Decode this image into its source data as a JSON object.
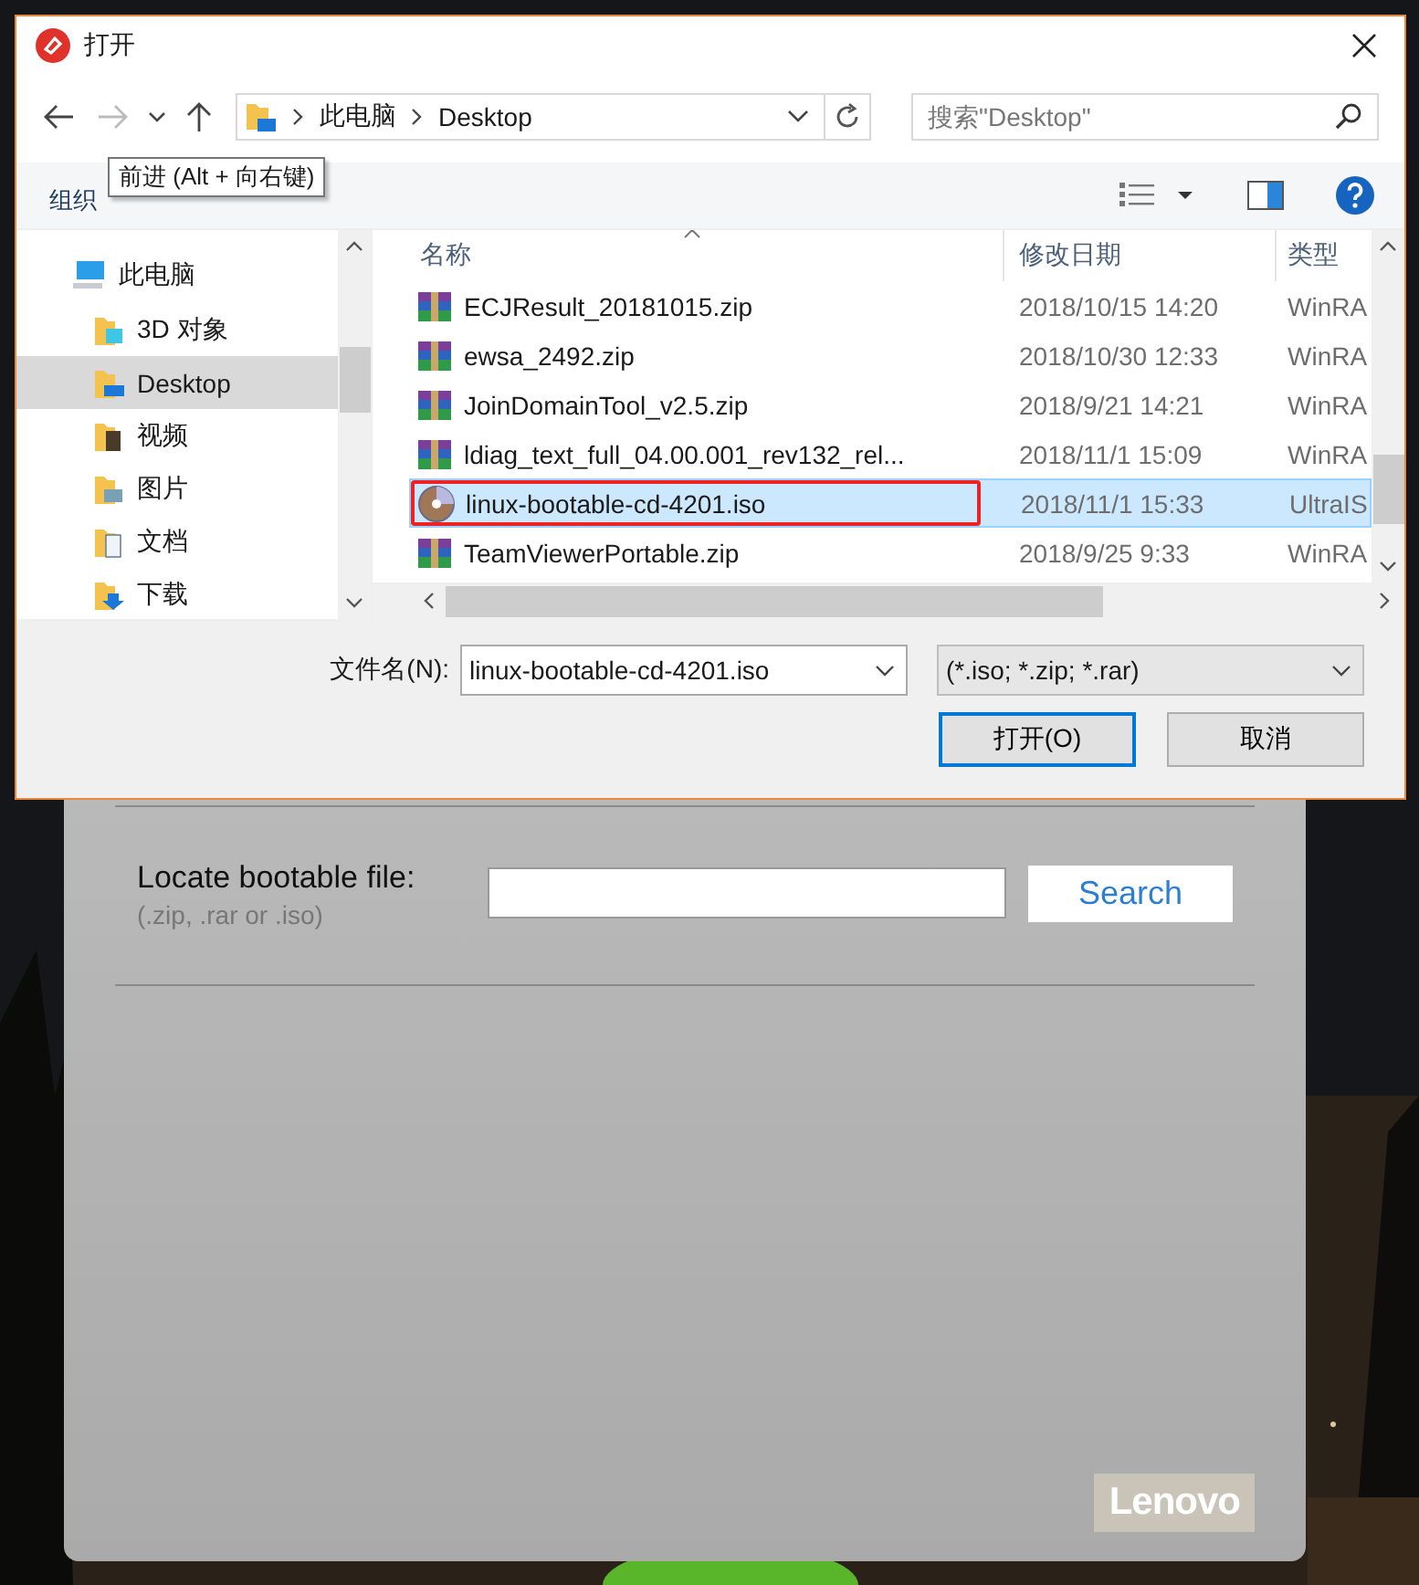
{
  "window": {
    "title": "打开"
  },
  "nav_buttons": [
    {
      "kind": "back",
      "disabled": false
    },
    {
      "kind": "forward",
      "disabled": true
    },
    {
      "kind": "recent",
      "disabled": false
    },
    {
      "kind": "up",
      "disabled": false
    }
  ],
  "address": {
    "crumbs": [
      "此电脑",
      "Desktop"
    ]
  },
  "search": {
    "placeholder": "搜索\"Desktop\""
  },
  "tooltip": "前进 (Alt + 向右键)",
  "toolbar": {
    "items": [
      "组织"
    ]
  },
  "sidebar": {
    "items": [
      {
        "label": "此电脑",
        "kind": "computer",
        "selected": false,
        "children": [
          {
            "label": "3D 对象",
            "kind": "objects",
            "selected": false
          },
          {
            "label": "Desktop",
            "kind": "desktop",
            "selected": true
          },
          {
            "label": "视频",
            "kind": "video",
            "selected": false
          },
          {
            "label": "图片",
            "kind": "pictures",
            "selected": false
          },
          {
            "label": "文档",
            "kind": "documents",
            "selected": false
          },
          {
            "label": "下载",
            "kind": "downloads",
            "selected": false
          }
        ]
      }
    ]
  },
  "table": {
    "columns": [
      "名称",
      "修改日期",
      "类型"
    ],
    "rows": [
      {
        "kind": "archive",
        "name": "ECJResult_20181015.zip",
        "date": "2018/10/15 14:20",
        "type": "WinRA",
        "selected": false,
        "annotated": false
      },
      {
        "kind": "archive",
        "name": "ewsa_2492.zip",
        "date": "2018/10/30 12:33",
        "type": "WinRA",
        "selected": false,
        "annotated": false
      },
      {
        "kind": "archive",
        "name": "JoinDomainTool_v2.5.zip",
        "date": "2018/9/21 14:21",
        "type": "WinRA",
        "selected": false,
        "annotated": false
      },
      {
        "kind": "archive",
        "name": "ldiag_text_full_04.00.001_rev132_rel...",
        "date": "2018/11/1 15:09",
        "type": "WinRA",
        "selected": false,
        "annotated": false
      },
      {
        "kind": "disc",
        "name": "linux-bootable-cd-4201.iso",
        "date": "2018/11/1 15:33",
        "type": "UltraIS",
        "selected": true,
        "annotated": true
      },
      {
        "kind": "archive",
        "name": "TeamViewerPortable.zip",
        "date": "2018/9/25 9:33",
        "type": "WinRA",
        "selected": false,
        "annotated": false
      }
    ]
  },
  "filename": {
    "label": "文件名(N):",
    "value": "linux-bootable-cd-4201.iso"
  },
  "filter": "(*.iso; *.zip; *.rar)",
  "buttons": [
    {
      "label": "打开(O)",
      "default": true
    },
    {
      "label": "取消",
      "default": false
    }
  ],
  "app": {
    "label": "Locate bootable file:",
    "hint": "(.zip, .rar or .iso)",
    "button": "Search",
    "logo": "Lenovo"
  }
}
